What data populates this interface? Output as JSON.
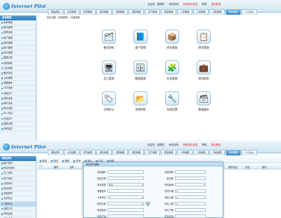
{
  "app": {
    "logo_text": "Internet Pilot"
  },
  "header": {
    "login_info": "欢迎您 · 管理员",
    "change_password": "修改密码",
    "announcement": "系统提示信息",
    "help": "帮助",
    "logout": "退出登录"
  },
  "nav": {
    "tabs": [
      "基础资料",
      "业务管理",
      "财务管理",
      "库存管理",
      "采购管理",
      "销售管理",
      "生产管理",
      "质量管理",
      "人事管理",
      "工资管理",
      "行政管理",
      "系统管理",
      "个人办公"
    ],
    "active_index": 11
  },
  "sidebar": {
    "title": "系统管理",
    "items": [
      "菜单管理",
      "模块管理",
      "权限设置",
      "用户管理",
      "角色管理",
      "部门管理",
      "岗位管理",
      "数据字典",
      "系统参数",
      "日志管理",
      "备份恢复",
      "公告管理",
      "单据编号",
      "打印设置",
      "流程定义",
      "审批设置",
      "邮件设置",
      "短信设置",
      "导入导出",
      "在线用户",
      "数据清理",
      "系统监控"
    ]
  },
  "breadcrumb": "当前位置：系统管理 > 功能菜单",
  "icons": [
    {
      "label": "基本资料",
      "glyph": "🗂"
    },
    {
      "label": "客户管理",
      "glyph": "📘"
    },
    {
      "label": "库存管理",
      "glyph": "📦"
    },
    {
      "label": "财务管理",
      "glyph": "📋"
    },
    {
      "label": "员工管理",
      "glyph": "🖥"
    },
    {
      "label": "数据管理",
      "glyph": "🗄"
    },
    {
      "label": "业务管理",
      "glyph": "🧩"
    },
    {
      "label": "财务报表",
      "glyph": "💼"
    },
    {
      "label": "日常办公",
      "glyph": "🏷"
    },
    {
      "label": "流程审批",
      "glyph": "📂"
    },
    {
      "label": "系统设置",
      "glyph": "🔧"
    },
    {
      "label": "数据备份",
      "glyph": "🗃"
    }
  ],
  "screen2": {
    "header": {
      "login_info": "欢迎您 · 管理员",
      "change_password": "修改密码",
      "announcement": "系统提示信息",
      "help": "帮助",
      "logout": "退出登录"
    },
    "sidebar": {
      "title": "基础资料",
      "items": [
        "客户资料",
        "供应商资料",
        "员工资料",
        "部门资料",
        "仓库资料",
        "商品资料",
        "商品类别",
        "往来单位",
        "计量单位",
        "结算方式",
        "币种设置",
        "地区设置"
      ],
      "active_index": 8
    },
    "toolbar": [
      "新增",
      "修改",
      "删除",
      "查询",
      "导出",
      "打印",
      "刷新"
    ],
    "grid_headers": [
      "编号",
      "名称",
      "类型",
      "联系人",
      "电话",
      "传真",
      "地址",
      "备注",
      "操作"
    ],
    "grid_right_headers": [
      "联系电话",
      "状态",
      "操作"
    ],
    "dialog": {
      "title": "商品资料编辑",
      "left_fields": [
        {
          "label": "商品编号",
          "value": "",
          "type": "input"
        },
        {
          "label": "商品名称",
          "value": "",
          "type": "input"
        },
        {
          "label": "商品类型",
          "value": "成品",
          "type": "select"
        },
        {
          "label": "规格型号",
          "value": "",
          "type": "input"
        },
        {
          "label": "计量单位",
          "value": "个",
          "type": "select"
        },
        {
          "label": "所属仓库",
          "value": "",
          "type": "select"
        },
        {
          "label": "商品条码",
          "value": "",
          "type": "input"
        },
        {
          "label": "商品产地",
          "value": "",
          "type": "input"
        }
      ],
      "right_fields": [
        {
          "label": "商品简称",
          "value": "",
          "type": "input"
        },
        {
          "label": "助记码",
          "value": "",
          "type": "input"
        },
        {
          "label": "商品品牌",
          "value": "",
          "type": "select"
        },
        {
          "label": "进货价格",
          "value": "0",
          "type": "input"
        },
        {
          "label": "销售价格",
          "value": "0",
          "type": "input"
        },
        {
          "label": "库存上限",
          "value": "0",
          "type": "input"
        },
        {
          "label": "库存下限",
          "value": "",
          "type": "input"
        },
        {
          "label": "是否启用",
          "value": "",
          "type": "input"
        }
      ],
      "browse_label": "选择"
    }
  }
}
